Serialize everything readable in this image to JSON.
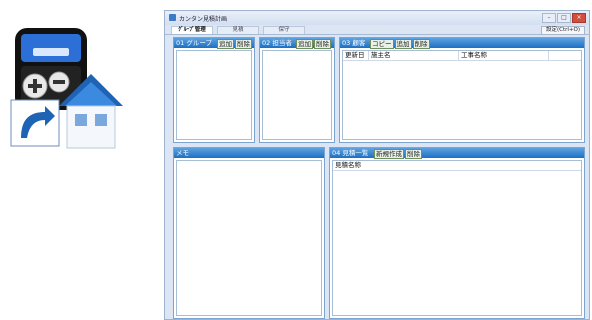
{
  "window": {
    "title": "カンタン見積計画",
    "controls": [
      "–",
      "□",
      "×"
    ]
  },
  "tabs": [
    {
      "label": "ｸﾞﾙｰﾌﾟ管理",
      "active": true
    },
    {
      "label": "見積",
      "active": false
    },
    {
      "label": "保守",
      "active": false
    }
  ],
  "settings_label": "設定(Ctrl+O)",
  "panels": {
    "group": {
      "title": "01 グループ",
      "add": "追加",
      "delete": "削除"
    },
    "person": {
      "title": "02 担当者",
      "add": "追加",
      "delete": "削除"
    },
    "customer": {
      "title": "03 顧客",
      "copy": "コピー",
      "add": "追加",
      "delete": "削除",
      "columns": [
        "更新日",
        "施主名",
        "工事名称"
      ]
    },
    "memo": {
      "title": "メモ"
    },
    "estimates": {
      "title": "04 見積一覧",
      "new": "新規作成",
      "delete": "削除",
      "columns": [
        "見積名称"
      ]
    }
  },
  "colors": {
    "header_blue": "#1d6fc4",
    "header_blue_light": "#5ea3e0",
    "window_bg": "#dbe5f3"
  }
}
